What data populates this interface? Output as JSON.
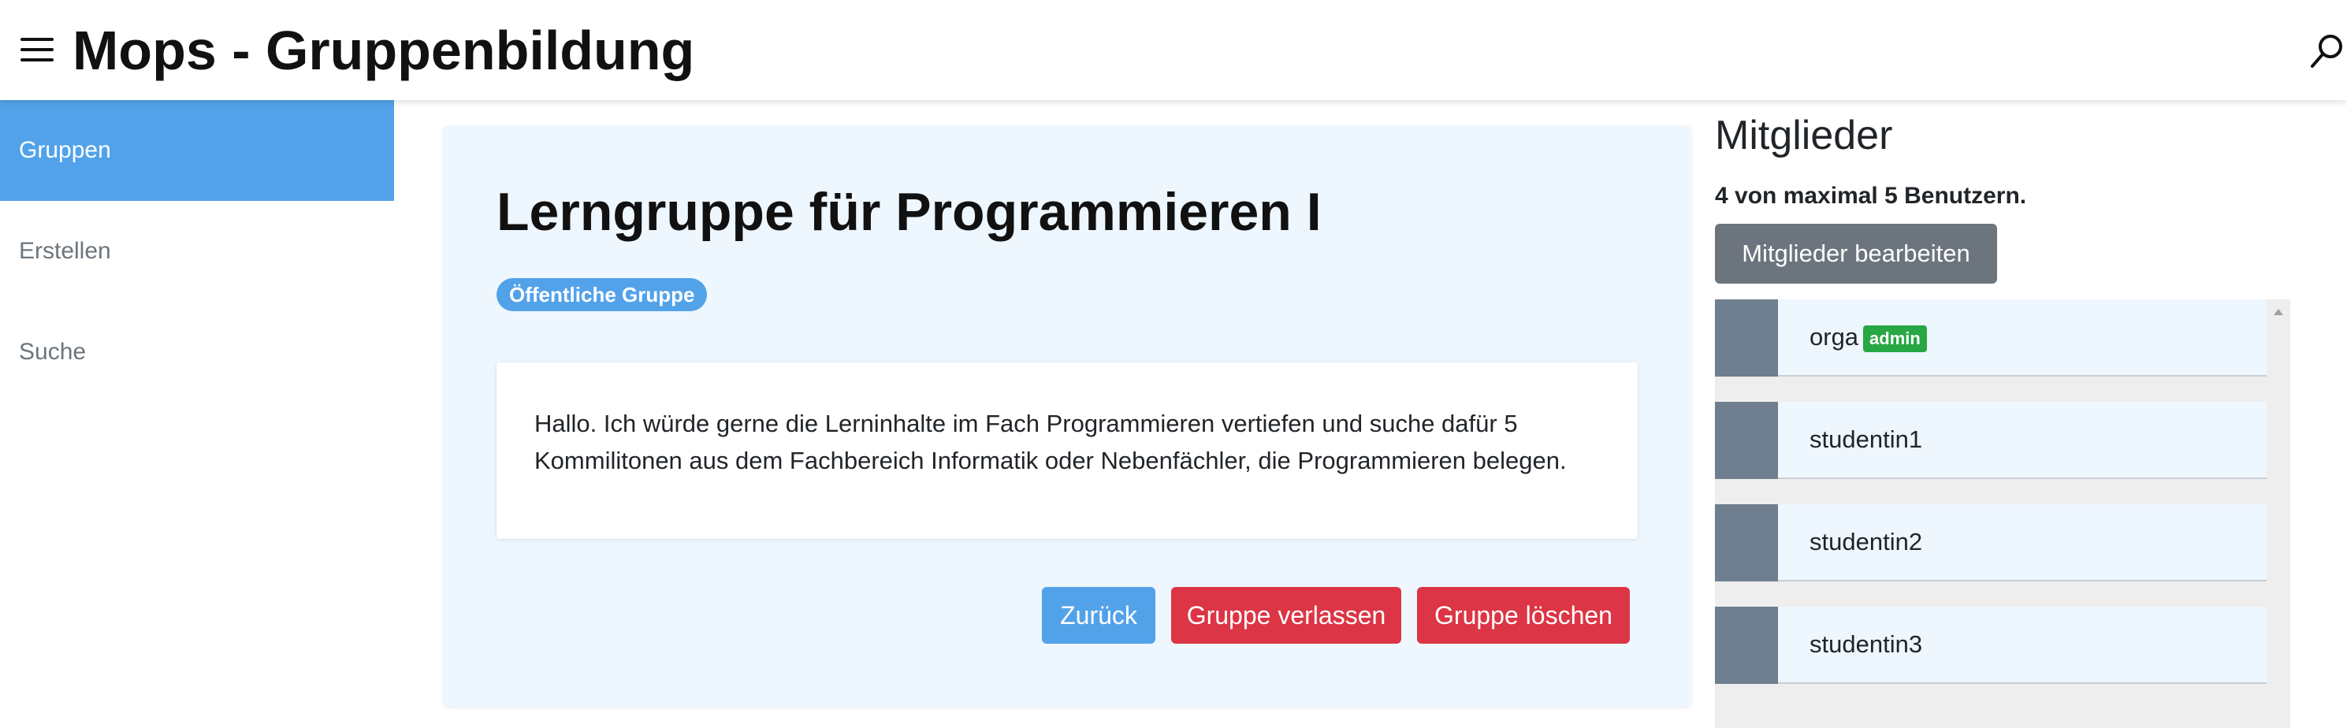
{
  "header": {
    "title": "Mops - Gruppenbildung",
    "menu_icon": "hamburger-menu-icon",
    "search_icon": "search-icon"
  },
  "sidebar": {
    "items": [
      {
        "label": "Gruppen",
        "active": true
      },
      {
        "label": "Erstellen",
        "active": false
      },
      {
        "label": "Suche",
        "active": false
      }
    ]
  },
  "group": {
    "title": "Lerngruppe für Programmieren I",
    "badge": "Öffentliche Gruppe",
    "description": "Hallo. Ich würde gerne die Lerninhalte im Fach Programmieren vertiefen und suche dafür 5 Kommilitonen aus dem Fachbereich Informatik oder Nebenfächler, die Programmieren belegen.",
    "buttons": {
      "back": "Zurück",
      "leave": "Gruppe verlassen",
      "delete": "Gruppe löschen"
    }
  },
  "members": {
    "title": "Mitglieder",
    "count_text": "4 von maximal 5 Benutzern.",
    "edit_button": "Mitglieder bearbeiten",
    "list": [
      {
        "name": "orga",
        "badge": "admin"
      },
      {
        "name": "studentin1"
      },
      {
        "name": "studentin2"
      },
      {
        "name": "studentin3"
      }
    ]
  },
  "colors": {
    "primary": "#52a2ea",
    "danger": "#dc3545",
    "secondary": "#6c757d",
    "success": "#28a745",
    "card_background": "#eef6fe"
  }
}
